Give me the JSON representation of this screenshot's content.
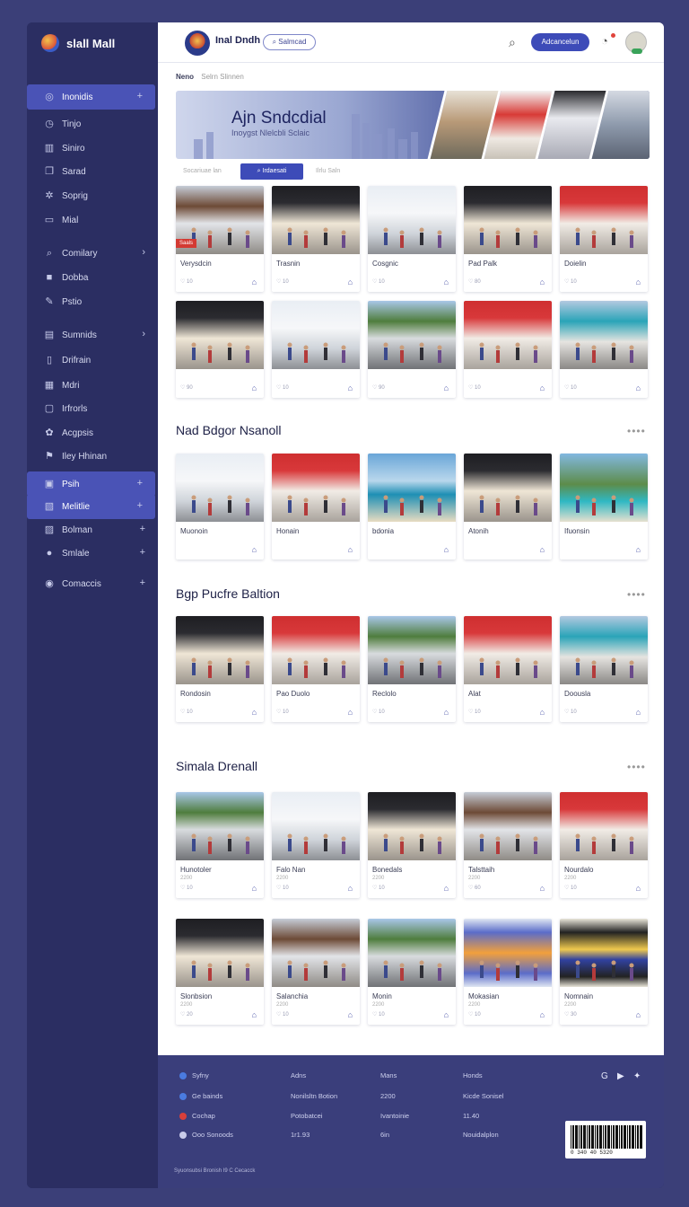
{
  "brand": {
    "name": "slall Mall"
  },
  "sidebar": {
    "items": [
      {
        "label": "Inonidis",
        "icon": "store-icon",
        "tail": "+",
        "active": true
      },
      {
        "label": "Tinjo",
        "icon": "clock-icon"
      },
      {
        "label": "Siniro",
        "icon": "grid-icon"
      },
      {
        "label": "Sarad",
        "icon": "copy-icon"
      },
      {
        "label": "Soprig",
        "icon": "sparkle-icon"
      },
      {
        "label": "Mial",
        "icon": "screen-icon"
      },
      {
        "label": "Comilary",
        "icon": "search-icon",
        "tail": "›"
      },
      {
        "label": "Dobba",
        "icon": "square-icon"
      },
      {
        "label": "Pstio",
        "icon": "pen-icon"
      },
      {
        "label": "Sumnids",
        "icon": "inbox-icon",
        "tail": "›"
      },
      {
        "label": "Drifrain",
        "icon": "doc-icon"
      },
      {
        "label": "Mdri",
        "icon": "layout-icon"
      },
      {
        "label": "Irfrorls",
        "icon": "file-icon"
      },
      {
        "label": "Acgpsis",
        "icon": "flower-icon"
      },
      {
        "label": "Iley Hhinan",
        "icon": "tag-icon"
      },
      {
        "label": "Psih",
        "icon": "image-icon",
        "tail": "+",
        "active": true
      },
      {
        "label": "Melitlie",
        "icon": "frame-icon",
        "tail": "+",
        "active": true
      },
      {
        "label": "Bolman",
        "icon": "gallery-icon",
        "tail": "+"
      },
      {
        "label": "Smlale",
        "icon": "check-circle-icon",
        "tail": "+"
      },
      {
        "label": "Comaccis",
        "icon": "info-icon",
        "tail": "+"
      }
    ]
  },
  "topbar": {
    "title": "Inal Dndh",
    "chip": "⌕ Salmcad",
    "button": "Adcancelun"
  },
  "breadcrumb": {
    "current": "Neno",
    "rest": "Selrn Slinnen"
  },
  "hero": {
    "title": "Ajn Sndcdial",
    "subtitle": "Inoygst Nlelcbli Sclaic"
  },
  "tabs": [
    "Socariuae lan",
    "⌕ Irdaesati",
    "Ilrlu Saln"
  ],
  "grid1": [
    {
      "label": "Verysdcin",
      "meta": "♡ 10",
      "badge": "Saals",
      "theme": "glass"
    },
    {
      "label": "Trasnin",
      "meta": "♡ 10",
      "theme": "dark"
    },
    {
      "label": "Cosgnic",
      "meta": "♡ 10",
      "theme": "bright"
    },
    {
      "label": "Pad Palk",
      "meta": "♡ 80",
      "theme": "dark"
    },
    {
      "label": "Doielin",
      "meta": "♡ 10",
      "theme": "red"
    },
    {
      "label": "",
      "meta": "♡ 90",
      "theme": "dark"
    },
    {
      "label": "",
      "meta": "♡ 10",
      "theme": "bright"
    },
    {
      "label": "",
      "meta": "♡ 90",
      "theme": "palm"
    },
    {
      "label": "",
      "meta": "♡ 10",
      "theme": "red"
    },
    {
      "label": "",
      "meta": "♡ 10",
      "theme": "teal"
    }
  ],
  "section2": {
    "title": "Nad Bdgor Nsanoll",
    "more": "••••",
    "cards": [
      {
        "label": "Muonoin",
        "theme": "bright"
      },
      {
        "label": "Honain",
        "theme": "red"
      },
      {
        "label": "bdonia",
        "theme": "beach"
      },
      {
        "label": "Atonih",
        "theme": "dark"
      },
      {
        "label": "Ifuonsin",
        "theme": "coast"
      }
    ]
  },
  "section3": {
    "title": "Bgp Pucfre Baltion",
    "more": "••••",
    "cards": [
      {
        "label": "Rondosin",
        "meta": "♡ 10",
        "theme": "dark"
      },
      {
        "label": "Pao Duolo",
        "meta": "♡ 10",
        "theme": "red"
      },
      {
        "label": "Reclolo",
        "meta": "♡ 10",
        "theme": "palm"
      },
      {
        "label": "Alat",
        "meta": "♡ 10",
        "theme": "red"
      },
      {
        "label": "Doousla",
        "meta": "♡ 10",
        "theme": "teal"
      }
    ]
  },
  "section4": {
    "title": "Simala Drenall",
    "more": "••••",
    "cards": [
      {
        "label": "Hunotoler",
        "sub": "2200",
        "meta": "♡ 10",
        "theme": "palm"
      },
      {
        "label": "Falo Nan",
        "sub": "2200",
        "meta": "♡ 10",
        "theme": "bright"
      },
      {
        "label": "Bonedals",
        "sub": "2200",
        "meta": "♡ 10",
        "theme": "dark"
      },
      {
        "label": "Talsttaih",
        "sub": "2200",
        "meta": "♡ 60",
        "theme": "glass"
      },
      {
        "label": "Nourdalo",
        "sub": "2200",
        "meta": "♡ 10",
        "theme": "red"
      },
      {
        "label": "Slonbsion",
        "sub": "2200",
        "meta": "♡ 20",
        "theme": "dark"
      },
      {
        "label": "Salanchia",
        "sub": "2200",
        "meta": "♡ 10",
        "theme": "glass"
      },
      {
        "label": "Monin",
        "sub": "2200",
        "meta": "♡ 10",
        "theme": "palm"
      },
      {
        "label": "Mokasian",
        "sub": "2200",
        "meta": "♡ 10",
        "theme": "screen"
      },
      {
        "label": "Nomnain",
        "sub": "2200",
        "meta": "♡ 30",
        "theme": "tablet"
      }
    ]
  },
  "footer": {
    "col1": [
      {
        "text": "Syfny",
        "color": "#4a7be0"
      },
      {
        "text": "Ge bainds",
        "color": "#4a7be0"
      },
      {
        "text": "Cochap",
        "color": "#d93f3a"
      },
      {
        "text": "Ooo Sonoods",
        "color": "#c9ccea"
      }
    ],
    "col2": [
      "Adns",
      "Nonilsltn Botion",
      "Potobatcei",
      "1r1.93"
    ],
    "col3": [
      "Mans",
      "2200",
      "Ivantoinie",
      "6in"
    ],
    "col4": [
      "Honds",
      "Kicde Sonisel",
      "11.40",
      "Nouidalplon"
    ],
    "social": [
      "G",
      "▶",
      "✦"
    ],
    "barcode": "0 340 40 5320",
    "copyright": "Syuonsubsi Bronish I9 C Cecacck"
  }
}
